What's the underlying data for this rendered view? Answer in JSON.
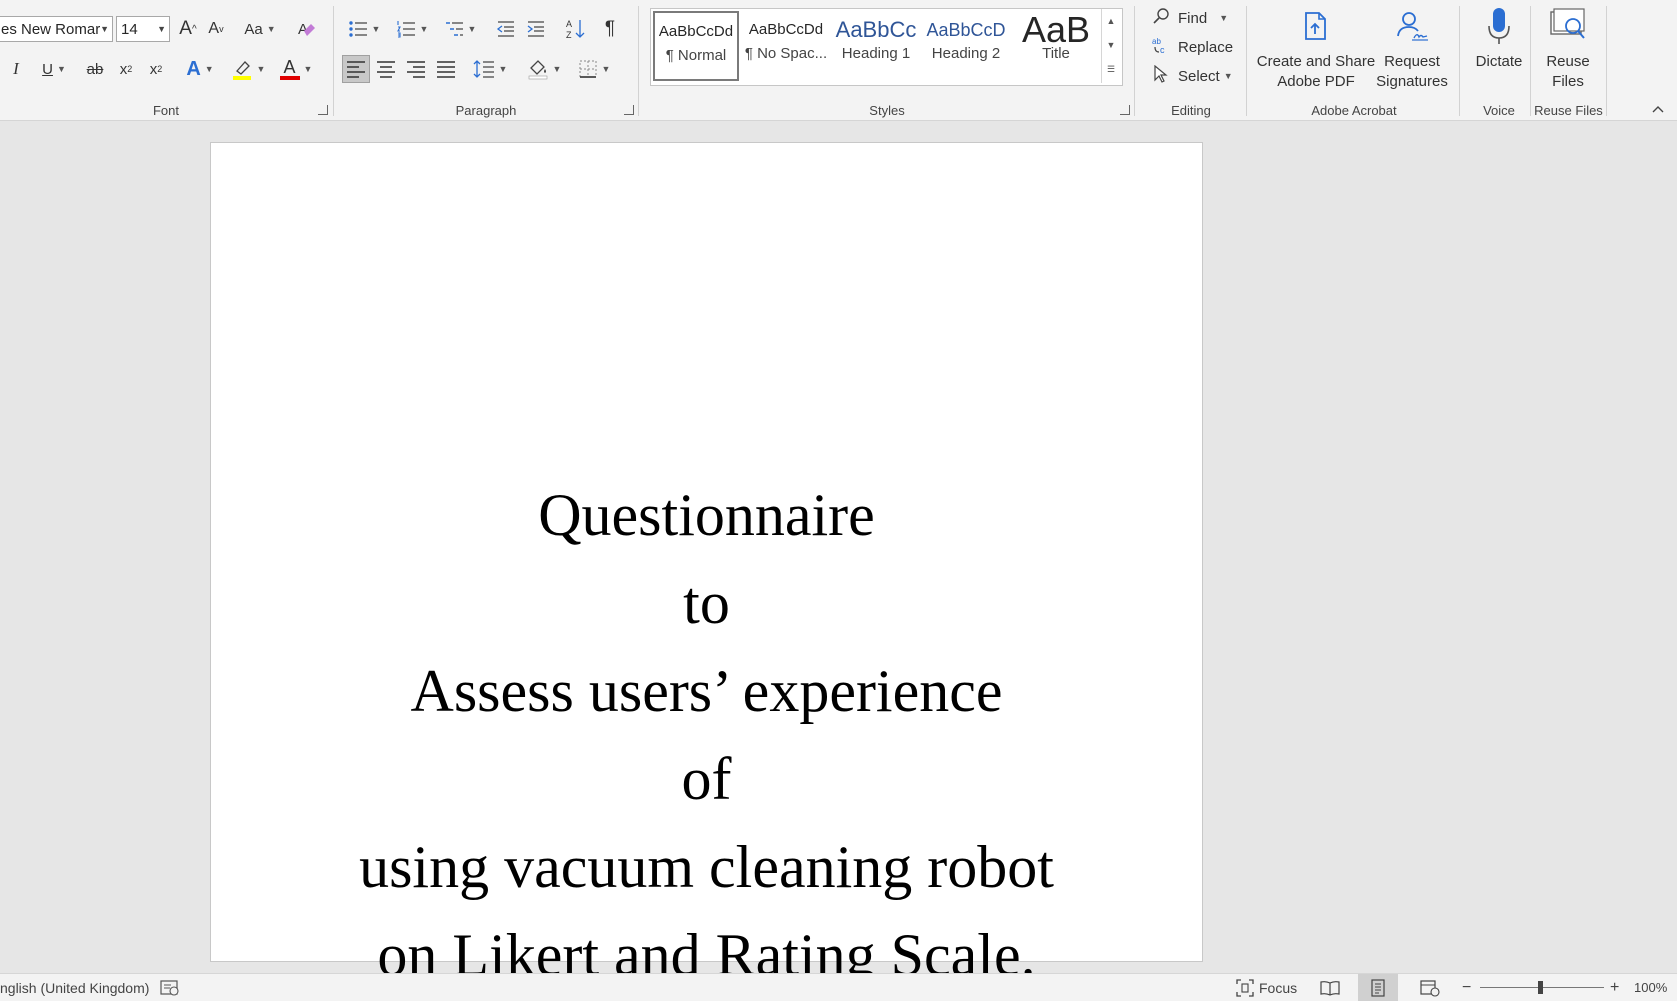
{
  "font_group": {
    "label": "Font",
    "font_name": "es New Romar",
    "font_size": "14",
    "grow_label": "A",
    "shrink_label": "A",
    "case_label": "Aa",
    "italic": "I",
    "underline": "U",
    "strike": "ab",
    "subscript_base": "x",
    "sub_mark": "2",
    "superscript_base": "x",
    "sup_mark": "2",
    "effects_label": "A",
    "font_color_label": "A",
    "highlight_color": "#ffff00",
    "font_color": "#e00000"
  },
  "paragraph_group": {
    "label": "Paragraph",
    "pilcrow": "¶"
  },
  "styles_group": {
    "label": "Styles",
    "items": [
      {
        "preview": "AaBbCcDd",
        "name": "¶ Normal"
      },
      {
        "preview": "AaBbCcDd",
        "name": "¶ No Spac..."
      },
      {
        "preview": "AaBbCc",
        "name": "Heading 1"
      },
      {
        "preview": "AaBbCcD",
        "name": "Heading 2"
      },
      {
        "preview": "AaB",
        "name": "Title"
      }
    ]
  },
  "editing_group": {
    "label": "Editing",
    "find": "Find",
    "replace": "Replace",
    "select": "Select"
  },
  "acrobat_group": {
    "label": "Adobe Acrobat",
    "create_line1": "Create and Share",
    "create_line2": "Adobe PDF",
    "request_line1": "Request",
    "request_line2": "Signatures"
  },
  "voice_group": {
    "label": "Voice",
    "dictate": "Dictate"
  },
  "reuse_group": {
    "label": "Reuse Files",
    "reuse_line1": "Reuse",
    "reuse_line2": "Files"
  },
  "document": {
    "lines": [
      "Questionnaire",
      "to",
      "Assess users’ experience",
      "of",
      "using vacuum cleaning robot",
      "on Likert and Rating Scale."
    ]
  },
  "status_bar": {
    "language": "nglish (United Kingdom)",
    "focus": "Focus",
    "zoom": "100%",
    "zoom_level_percent": 100
  },
  "colors": {
    "ribbon_bg": "#f3f3f3",
    "accent_blue": "#2b6ed2",
    "canvas_bg": "#e6e6e6"
  }
}
